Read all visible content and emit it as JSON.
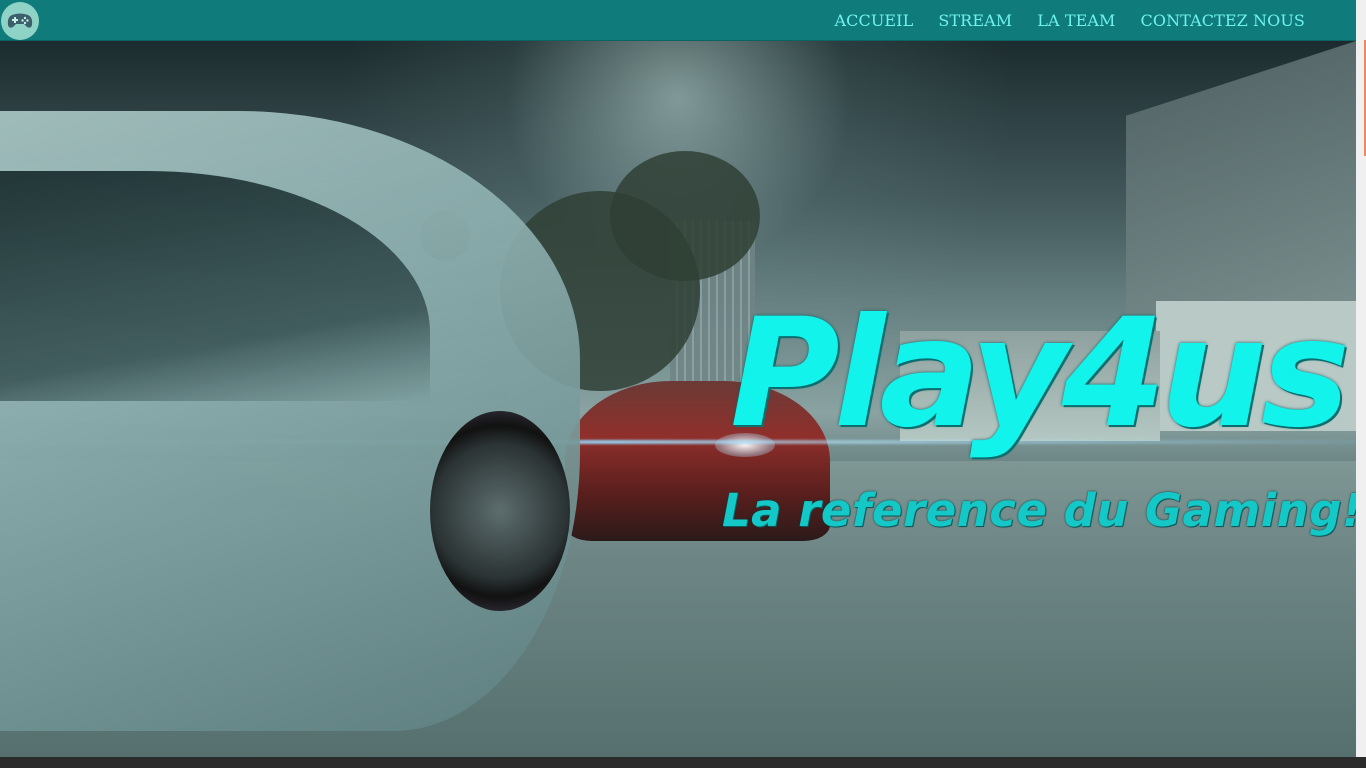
{
  "navbar": {
    "logo_icon": "gamepad-icon",
    "links": [
      "ACCUEIL",
      "STREAM",
      "LA TEAM",
      "CONTACTEZ NOUS"
    ]
  },
  "hero": {
    "title": "Play4us",
    "tagline": "La reference du Gaming!"
  },
  "colors": {
    "navbar_bg": "#0f7b7b",
    "nav_link": "#6ff2ee",
    "title": "#12f3eb",
    "tagline": "#13c8c6",
    "scroll_thumb": "#e98a5f"
  }
}
